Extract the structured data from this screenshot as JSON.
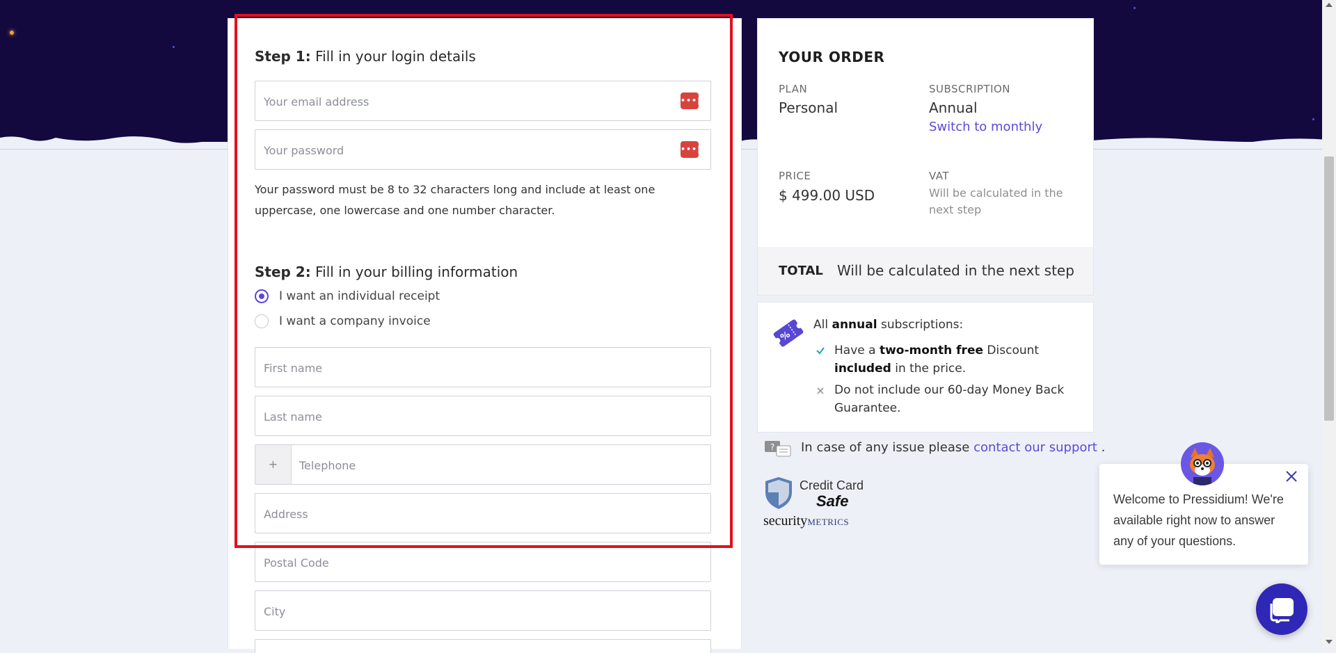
{
  "step1": {
    "prefix": "Step 1:",
    "title": "Fill in your login details",
    "email_placeholder": "Your email address",
    "password_placeholder": "Your password",
    "password_hint": "Your password must be 8 to 32 characters long and include at least one uppercase, one lowercase and one number character."
  },
  "step2": {
    "prefix": "Step 2:",
    "title": "Fill in your billing information",
    "radio_individual": "I want an individual receipt",
    "radio_company": "I want a company invoice",
    "selected": "individual",
    "first_name_placeholder": "First name",
    "last_name_placeholder": "Last name",
    "tel_prefix": "+",
    "telephone_placeholder": "Telephone",
    "address_placeholder": "Address",
    "postal_placeholder": "Postal Code",
    "city_placeholder": "City"
  },
  "order": {
    "title": "YOUR ORDER",
    "plan_label": "PLAN",
    "plan_value": "Personal",
    "subscription_label": "SUBSCRIPTION",
    "subscription_value": "Annual",
    "switch_link": "Switch to monthly",
    "price_label": "PRICE",
    "price_value": "$ 499.00 USD",
    "vat_label": "VAT",
    "vat_note": "Will be calculated in the next step",
    "total_label": "TOTAL",
    "total_value": "Will be calculated in the next step"
  },
  "promo": {
    "all": "All",
    "annual": "annual",
    "subscriptions": "subscriptions:",
    "have_a": "Have a",
    "two_month_free": "two-month free",
    "discount": "Discount",
    "included": "included",
    "in_the_price": "in the price.",
    "no_money_back": "Do not include our 60-day Money Back Guarantee."
  },
  "support": {
    "text": "In case of any issue please",
    "link": "contact our support",
    "end": "."
  },
  "security_logo": {
    "line1": "Credit Card",
    "line2": "Safe",
    "brand1": "security",
    "brand2": "METRICS"
  },
  "chat": {
    "message": "Welcome to Pressidium! We're available right now to answer any of your questions."
  },
  "colors": {
    "hero_bg": "#13093f",
    "accent": "#5b4ad6",
    "highlight": "#e3101c",
    "password_badge": "#d9433d",
    "chat_button": "#2f27b5"
  }
}
